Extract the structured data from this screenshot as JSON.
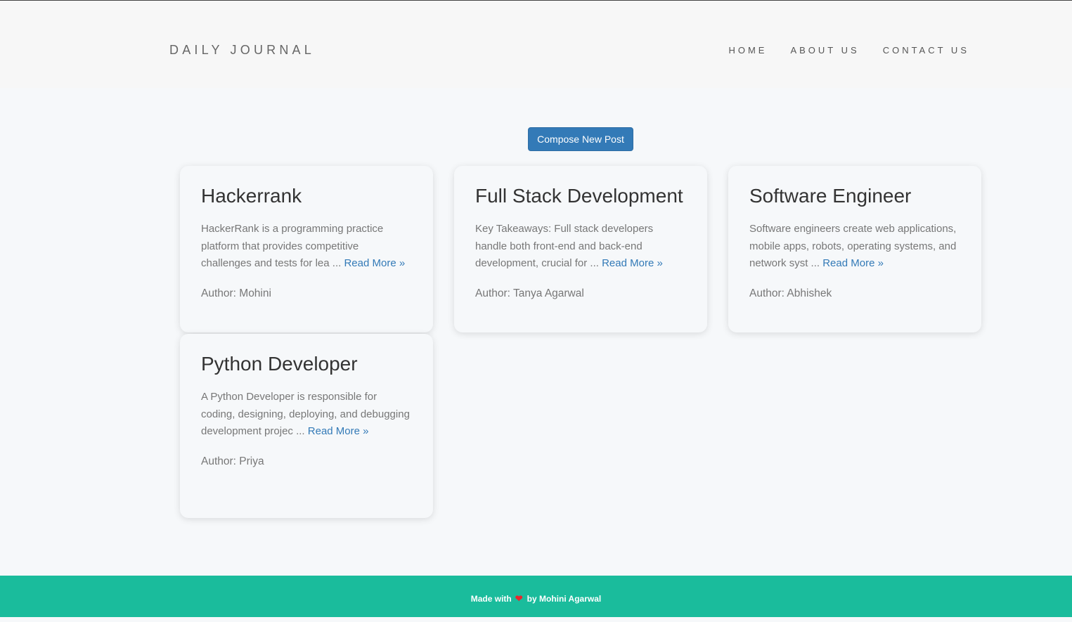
{
  "brand": "DAILY JOURNAL",
  "nav": {
    "home": "HOME",
    "about": "ABOUT US",
    "contact": "CONTACT US"
  },
  "compose_label": "Compose New Post",
  "posts": [
    {
      "title": "Hackerrank",
      "excerpt": "HackerRank is a programming practice platform that provides competitive challenges and tests for lea",
      "ellipsis": " ... ",
      "read_more": "Read More »",
      "author": "Author: Mohini"
    },
    {
      "title": "Full Stack Development",
      "excerpt": "Key Takeaways: Full stack developers handle both front-end and back-end development, crucial for",
      "ellipsis": " ... ",
      "read_more": "Read More »",
      "author": "Author: Tanya Agarwal"
    },
    {
      "title": "Software Engineer",
      "excerpt": "Software engineers create web applications, mobile apps, robots, operating systems, and network syst",
      "ellipsis": " ... ",
      "read_more": "Read More »",
      "author": "Author: Abhishek"
    },
    {
      "title": "Python Developer",
      "excerpt": "A Python Developer is responsible for coding, designing, deploying, and debugging development projec",
      "ellipsis": " ... ",
      "read_more": "Read More »",
      "author": "Author: Priya"
    }
  ],
  "footer": {
    "made_with": "Made with",
    "by": "by Mohini Agarwal",
    "heart_icon": "heart-icon"
  },
  "colors": {
    "primary_button": "#337ab7",
    "footer_bg": "#1abc9c",
    "link": "#337ab7",
    "heart": "#e8262d"
  }
}
